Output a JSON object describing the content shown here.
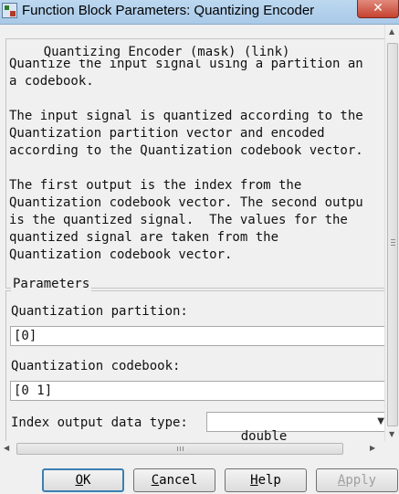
{
  "window": {
    "title": "Function Block Parameters: Quantizing Encoder",
    "close_glyph": "✕"
  },
  "mask": {
    "group_title": "Quantizing Encoder (mask) (link)",
    "description_lines": [
      "Quantize the input signal using a partition an",
      "a codebook.",
      "",
      "The input signal is quantized according to the",
      "Quantization partition vector and encoded",
      "according to the Quantization codebook vector.",
      "",
      "The first output is the index from the",
      "Quantization codebook vector. The second outpu",
      "is the quantized signal.  The values for the",
      "quantized signal are taken from the",
      "Quantization codebook vector."
    ]
  },
  "parameters": {
    "group_title": "Parameters",
    "partition_label": "Quantization partition:",
    "partition_value": "[0]",
    "codebook_label": "Quantization codebook:",
    "codebook_value": "[0 1]",
    "index_type_label": "Index output data type:",
    "index_type_value": "double"
  },
  "buttons": {
    "ok_prefix": "O",
    "ok_rest": "K",
    "cancel_prefix": "C",
    "cancel_rest": "ancel",
    "help_prefix": "H",
    "help_rest": "elp",
    "apply_prefix": "A",
    "apply_rest": "pply"
  },
  "icons": {
    "app": "simulink-block-icon",
    "close": "close-icon",
    "dropdown": "chevron-down-icon"
  }
}
